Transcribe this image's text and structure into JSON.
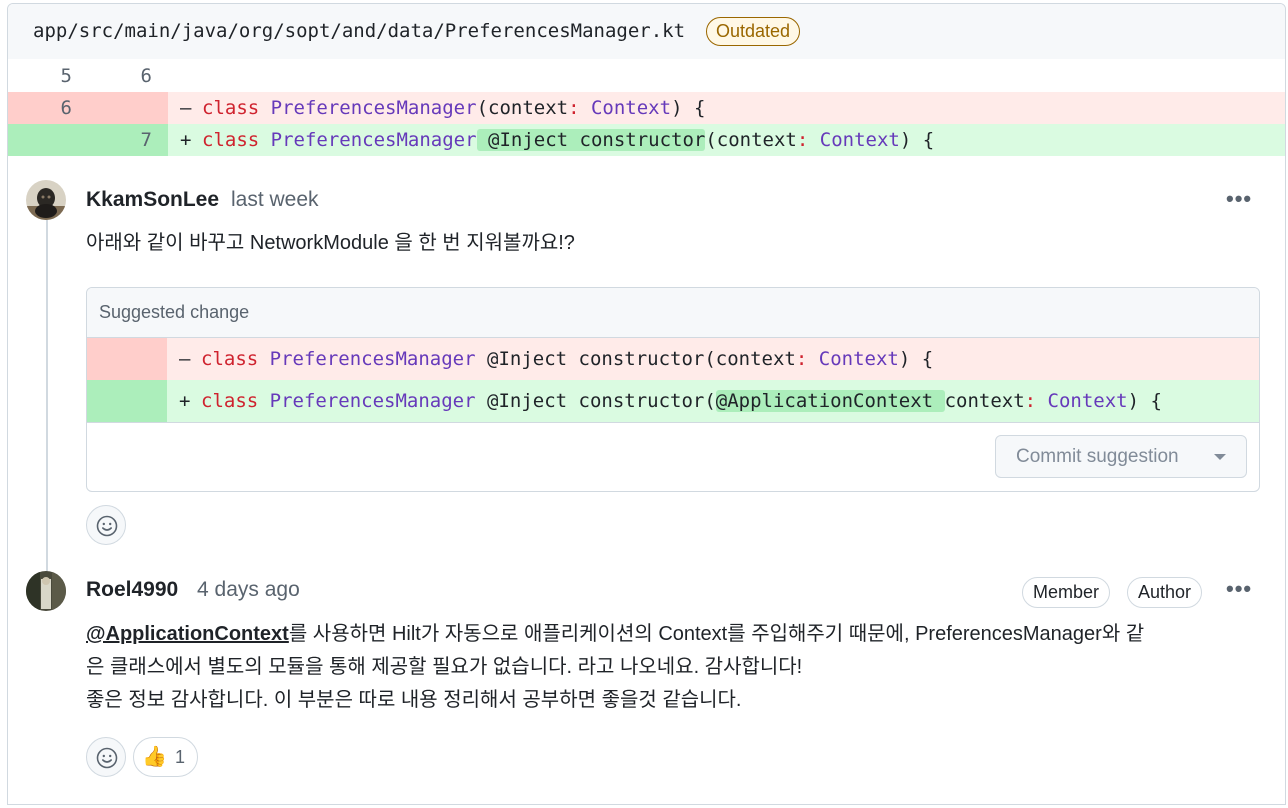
{
  "file": {
    "path": "app/src/main/java/org/sopt/and/data/PreferencesManager.kt",
    "badge": "Outdated"
  },
  "diff": {
    "ctx": {
      "old": "5",
      "new": "6"
    },
    "del": {
      "old": "6",
      "sign": "–",
      "kw": "class",
      "type": "PreferencesManager",
      "p1": "(context",
      "colon": ":",
      "ctype": "Context",
      "end": ") {"
    },
    "add": {
      "new": "7",
      "sign": "+",
      "kw": "class",
      "type": "PreferencesManager",
      "hl": " @Inject constructor",
      "p1": "(context",
      "colon": ":",
      "ctype": "Context",
      "end": ") {"
    }
  },
  "comments": [
    {
      "author": "KkamSonLee",
      "time": "last week",
      "body": "아래와 같이 바꾸고 NetworkModule 을 한 번 지워볼까요!?",
      "suggestion": {
        "title": "Suggested change",
        "del": {
          "sign": "–",
          "kw": "class",
          "type": "PreferencesManager",
          "mid": " @Inject constructor(context",
          "colon": ":",
          "ctype": "Context",
          "end": ") {"
        },
        "add": {
          "sign": "+",
          "kw": "class",
          "type": "PreferencesManager",
          "mid": " @Inject constructor(",
          "hl": "@ApplicationContext ",
          "p1": "context",
          "colon": ":",
          "ctype": "Context",
          "end": ") {"
        },
        "commit_label": "Commit suggestion"
      }
    },
    {
      "author": "Roel4990",
      "time": "4 days ago",
      "badges": [
        "Member",
        "Author"
      ],
      "mention": "@ApplicationContext",
      "body_line1": "를 사용하면 Hilt가 자동으로 애플리케이션의 Context를 주입해주기 때문에, PreferencesManager와 같",
      "body_line2": "은 클래스에서 별도의 모듈을 통해 제공할 필요가 없습니다. 라고 나오네요. 감사합니다!",
      "body_line3": "좋은 정보 감사합니다. 이 부분은 따로 내용 정리해서 공부하면 좋을것 같습니다.",
      "reactions": [
        {
          "emoji": "👍",
          "count": "1"
        }
      ]
    }
  ],
  "icons": {
    "kebab": "kebab-horizontal-icon",
    "smiley": "smiley-icon",
    "caret": "triangle-down-icon"
  },
  "kebab_glyph": "•••"
}
